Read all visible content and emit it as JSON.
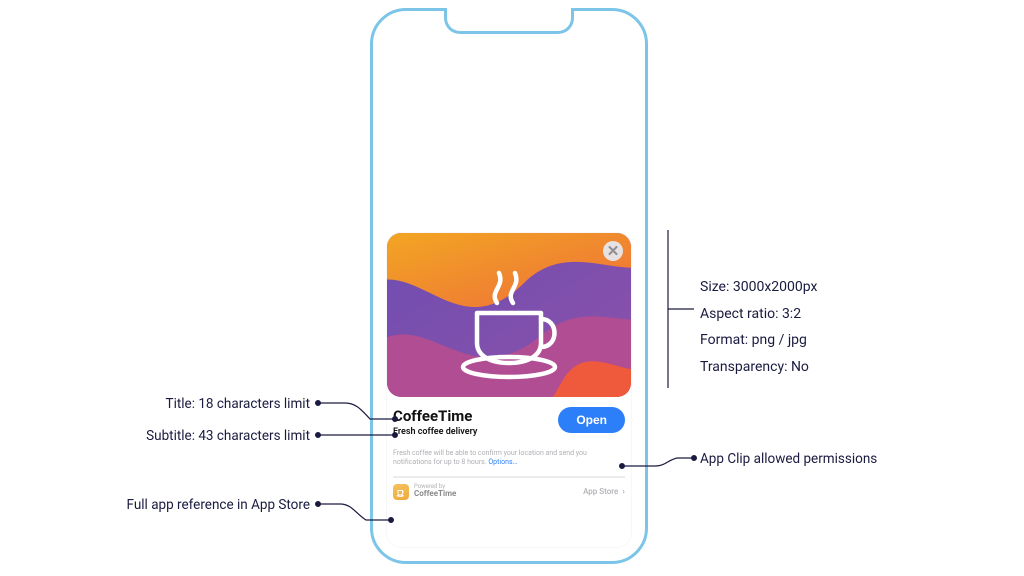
{
  "card": {
    "title": "CoffeeTime",
    "subtitle": "Fresh coffee delivery",
    "open_label": "Open",
    "permissions_text": "Fresh coffee will be able to confirm your location and send you notifications for up to 8 hours. ",
    "permissions_link": "Options…",
    "powered_by_label": "Powered by",
    "powered_by_name": "CoffeeTime",
    "store_label": "App Store"
  },
  "callouts": {
    "title_limit": "Title: 18 characters limit",
    "subtitle_limit": "Subtitle: 43 characters limit",
    "full_app_ref": "Full app reference in App Store",
    "permissions_label": "App Clip allowed permissions"
  },
  "specs": {
    "size": "Size: 3000x2000px",
    "aspect": "Aspect ratio: 3:2",
    "format": "Format: png / jpg",
    "transparency": "Transparency: No"
  }
}
